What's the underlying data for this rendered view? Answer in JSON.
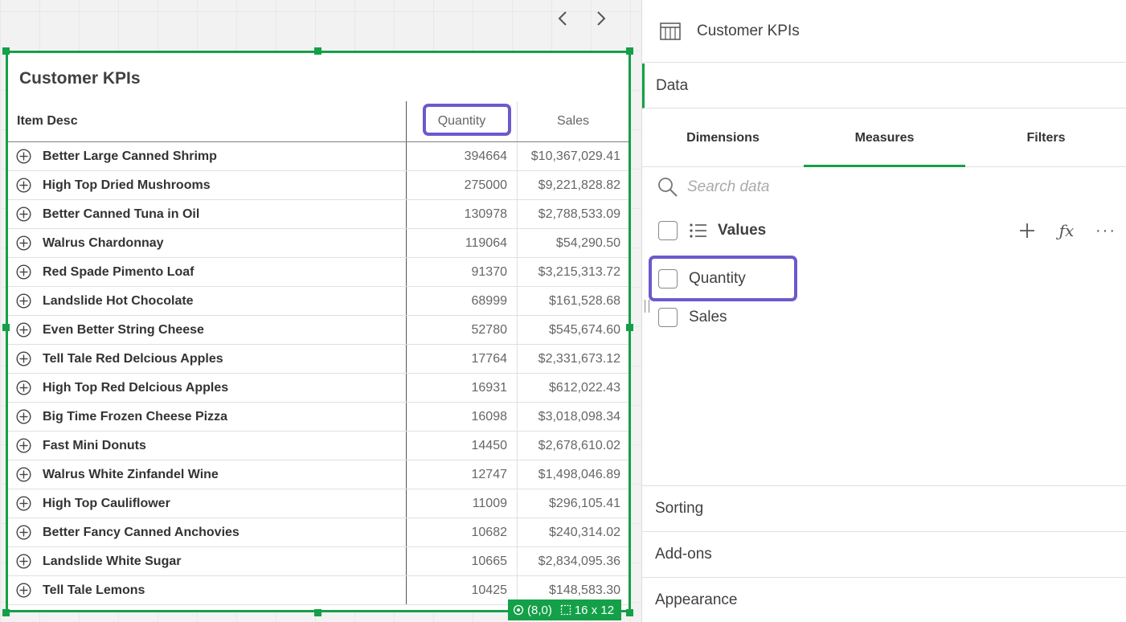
{
  "canvas": {
    "table": {
      "title": "Customer KPIs",
      "columns": {
        "item": "Item Desc",
        "quantity": "Quantity",
        "sales": "Sales"
      },
      "rows": [
        {
          "item": "Better Large Canned Shrimp",
          "quantity": "394664",
          "sales": "$10,367,029.41"
        },
        {
          "item": "High Top Dried Mushrooms",
          "quantity": "275000",
          "sales": "$9,221,828.82"
        },
        {
          "item": "Better Canned Tuna in Oil",
          "quantity": "130978",
          "sales": "$2,788,533.09"
        },
        {
          "item": "Walrus Chardonnay",
          "quantity": "119064",
          "sales": "$54,290.50"
        },
        {
          "item": "Red Spade Pimento Loaf",
          "quantity": "91370",
          "sales": "$3,215,313.72"
        },
        {
          "item": "Landslide Hot Chocolate",
          "quantity": "68999",
          "sales": "$161,528.68"
        },
        {
          "item": "Even Better String Cheese",
          "quantity": "52780",
          "sales": "$545,674.60"
        },
        {
          "item": "Tell Tale Red Delcious Apples",
          "quantity": "17764",
          "sales": "$2,331,673.12"
        },
        {
          "item": "High Top Red Delcious Apples",
          "quantity": "16931",
          "sales": "$612,022.43"
        },
        {
          "item": "Big Time Frozen Cheese Pizza",
          "quantity": "16098",
          "sales": "$3,018,098.34"
        },
        {
          "item": "Fast Mini Donuts",
          "quantity": "14450",
          "sales": "$2,678,610.02"
        },
        {
          "item": "Walrus White Zinfandel Wine",
          "quantity": "12747",
          "sales": "$1,498,046.89"
        },
        {
          "item": "High Top Cauliflower",
          "quantity": "11009",
          "sales": "$296,105.41"
        },
        {
          "item": "Better Fancy Canned Anchovies",
          "quantity": "10682",
          "sales": "$240,314.02"
        },
        {
          "item": "Landslide White Sugar",
          "quantity": "10665",
          "sales": "$2,834,095.36"
        },
        {
          "item": "Tell Tale Lemons",
          "quantity": "10425",
          "sales": "$148,583.30"
        }
      ]
    },
    "status": {
      "position": "(8,0)",
      "size": "16 x 12"
    },
    "accent_color": "#14a048",
    "highlight_color": "#6a5acd"
  },
  "panel": {
    "header_title": "Customer KPIs",
    "header_icon": "table-icon",
    "section_data": "Data",
    "tabs": [
      "Dimensions",
      "Measures",
      "Filters"
    ],
    "active_tab": "Measures",
    "search_placeholder": "Search data",
    "values_label": "Values",
    "measures": [
      "Quantity",
      "Sales"
    ],
    "sections": [
      "Sorting",
      "Add-ons",
      "Appearance"
    ]
  }
}
